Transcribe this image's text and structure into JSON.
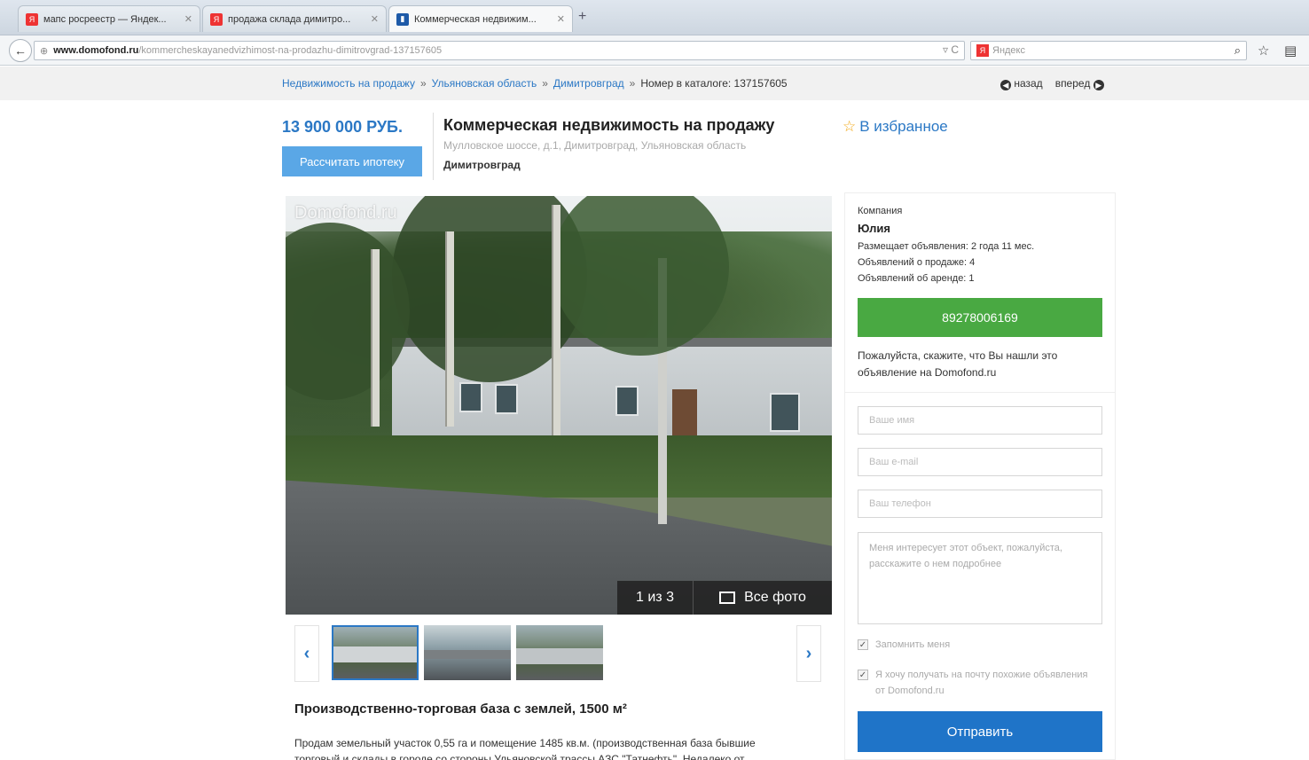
{
  "browser": {
    "tabs": [
      {
        "title": "мапс росреестр — Яндек...",
        "favicon": "yandex-icon"
      },
      {
        "title": "продажа склада димитро...",
        "favicon": "yandex-icon"
      },
      {
        "title": "Коммерческая недвижим...",
        "favicon": "bookmark-icon"
      }
    ],
    "url_domain": "www.domofond.ru",
    "url_path": "/kommercheskayanedvizhimost-na-prodazhu-dimitrovgrad-137157605",
    "search_placeholder": "Яндекс"
  },
  "breadcrumb": {
    "items": [
      "Недвижимость на продажу",
      "Ульяновская область",
      "Димитровград"
    ],
    "separator": "»",
    "current": "Номер в каталоге: 137157605",
    "back_label": "назад",
    "forward_label": "вперед"
  },
  "listing": {
    "price": "13 900 000 РУБ.",
    "mortgage_button": "Рассчитать ипотеку",
    "title": "Коммерческая недвижимость на продажу",
    "address": "Мулловское шоссе, д.1, Димитровград, Ульяновская область",
    "city": "Димитровград",
    "favorite_label": "В избранное"
  },
  "gallery": {
    "watermark": "Domofond.ru",
    "counter": "1 из 3",
    "all_photos_label": "Все фото",
    "thumbnail_count": 3
  },
  "description": {
    "heading": "Производственно-торговая база с землей, 1500 м²",
    "text_line1": "Продам земельный участок 0,55 га и помещение 1485 кв.м. (производственная база бывшие",
    "text_line2": "торговый и склады в городе со стороны Ульяновской трассы АЗС \"Татнефть\". Недалеко от..."
  },
  "contact": {
    "company_label": "Компания",
    "agent_name": "Юлия",
    "stats": [
      "Размещает объявления: 2 года 11 мес.",
      "Объявлений о продаже: 4",
      "Объявлений об аренде: 1"
    ],
    "phone": "89278006169",
    "note": "Пожалуйста, скажите, что Вы нашли это объявление на Domofond.ru",
    "name_placeholder": "Ваше имя",
    "email_placeholder": "Ваш e-mail",
    "phone_placeholder": "Ваш телефон",
    "message_value": "Меня интересует этот объект, пожалуйста, расскажите о нем подробнее",
    "remember_label": "Запомнить меня",
    "subscribe_label": "Я хочу получать на почту похожие объявления от Domofond.ru",
    "submit_label": "Отправить"
  },
  "colors": {
    "accent": "#2b78c5",
    "phone_button": "#49a942",
    "submit_button": "#1f74c8",
    "mortgage_button": "#5aa7e6"
  }
}
